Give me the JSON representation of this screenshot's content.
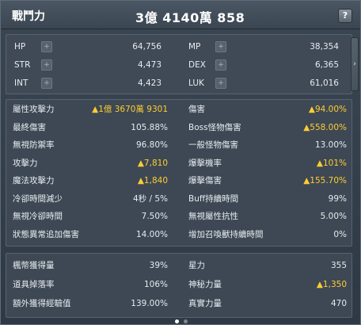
{
  "header": {
    "title": "戰鬥力",
    "value": "3億 4140萬 858",
    "help": "?"
  },
  "basic_stats": [
    {
      "name": "HP",
      "value": "64,756"
    },
    {
      "name": "MP",
      "value": "38,354"
    },
    {
      "name": "STR",
      "value": "4,473"
    },
    {
      "name": "DEX",
      "value": "6,365"
    },
    {
      "name": "INT",
      "value": "4,423"
    },
    {
      "name": "LUK",
      "value": "61,016"
    }
  ],
  "plus_glyph": "+",
  "arrow_glyph": "›",
  "detail_stats": [
    {
      "name": "屬性攻擊力",
      "value": "▲1億 3670萬 9301"
    },
    {
      "name": "傷害",
      "value": "▲94.00%"
    },
    {
      "name": "最終傷害",
      "value": "105.88%"
    },
    {
      "name": "Boss怪物傷害",
      "value": "▲558.00%"
    },
    {
      "name": "無視防禦率",
      "value": "96.80%"
    },
    {
      "name": "一般怪物傷害",
      "value": "13.00%"
    },
    {
      "name": "攻擊力",
      "value": "▲7,810"
    },
    {
      "name": "爆擊機率",
      "value": "▲101%"
    },
    {
      "name": "魔法攻擊力",
      "value": "▲1,840"
    },
    {
      "name": "爆擊傷害",
      "value": "▲155.70%"
    },
    {
      "name": "冷卻時間減少",
      "value": "4秒 / 5%"
    },
    {
      "name": "Buff持續時間",
      "value": "99%"
    },
    {
      "name": "無視冷卻時間",
      "value": "7.50%"
    },
    {
      "name": "無視屬性抗性",
      "value": "5.00%"
    },
    {
      "name": "狀態異常追加傷害",
      "value": "14.00%"
    },
    {
      "name": "增加召喚獸持續時間",
      "value": "0%"
    }
  ],
  "extra_stats": [
    {
      "name": "楓幣獲得量",
      "value": "39%"
    },
    {
      "name": "星力",
      "value": "355"
    },
    {
      "name": "道具掉落率",
      "value": "106%"
    },
    {
      "name": "神秘力量",
      "value": "▲1,350"
    },
    {
      "name": "額外獲得經驗值",
      "value": "139.00%"
    },
    {
      "name": "真實力量",
      "value": "470"
    }
  ],
  "colors": {
    "highlight": "#ffcc33",
    "panel": "#3d4854",
    "header": "#4a5663"
  },
  "pager": {
    "pages": 2,
    "active": 1
  }
}
